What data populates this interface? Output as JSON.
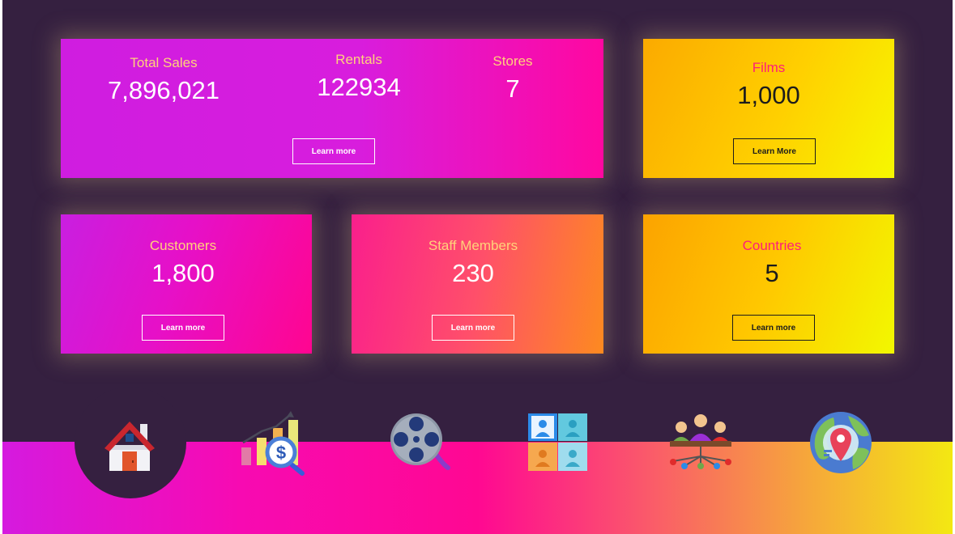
{
  "cards": {
    "sales": {
      "label": "Total Sales",
      "value": "7,896,021"
    },
    "rentals": {
      "label": "Rentals",
      "value": "122934"
    },
    "stores": {
      "label": "Stores",
      "value": "7"
    },
    "summary_button": "Learn more",
    "films": {
      "label": "Films",
      "value": "1,000",
      "button": "Learn More"
    },
    "customers": {
      "label": "Customers",
      "value": "1,800",
      "button": "Learn more"
    },
    "staff": {
      "label": "Staff Members",
      "value": "230",
      "button": "Learn more"
    },
    "countries": {
      "label": "Countries",
      "value": "5",
      "button": "Learn more"
    }
  },
  "nav": {
    "items": [
      {
        "icon": "house-icon",
        "active": true
      },
      {
        "icon": "sales-analytics-icon"
      },
      {
        "icon": "film-reel-icon"
      },
      {
        "icon": "staff-panel-icon"
      },
      {
        "icon": "meeting-people-icon"
      },
      {
        "icon": "globe-map-pin-icon"
      }
    ]
  },
  "colors": {
    "background": "#352040",
    "pink": "#ff08a0",
    "purple": "#cf1de0",
    "yellow": "#f6f800",
    "orange": "#fbaa00",
    "label_gold": "#ffd27a",
    "label_pink": "#ff1d7a"
  }
}
